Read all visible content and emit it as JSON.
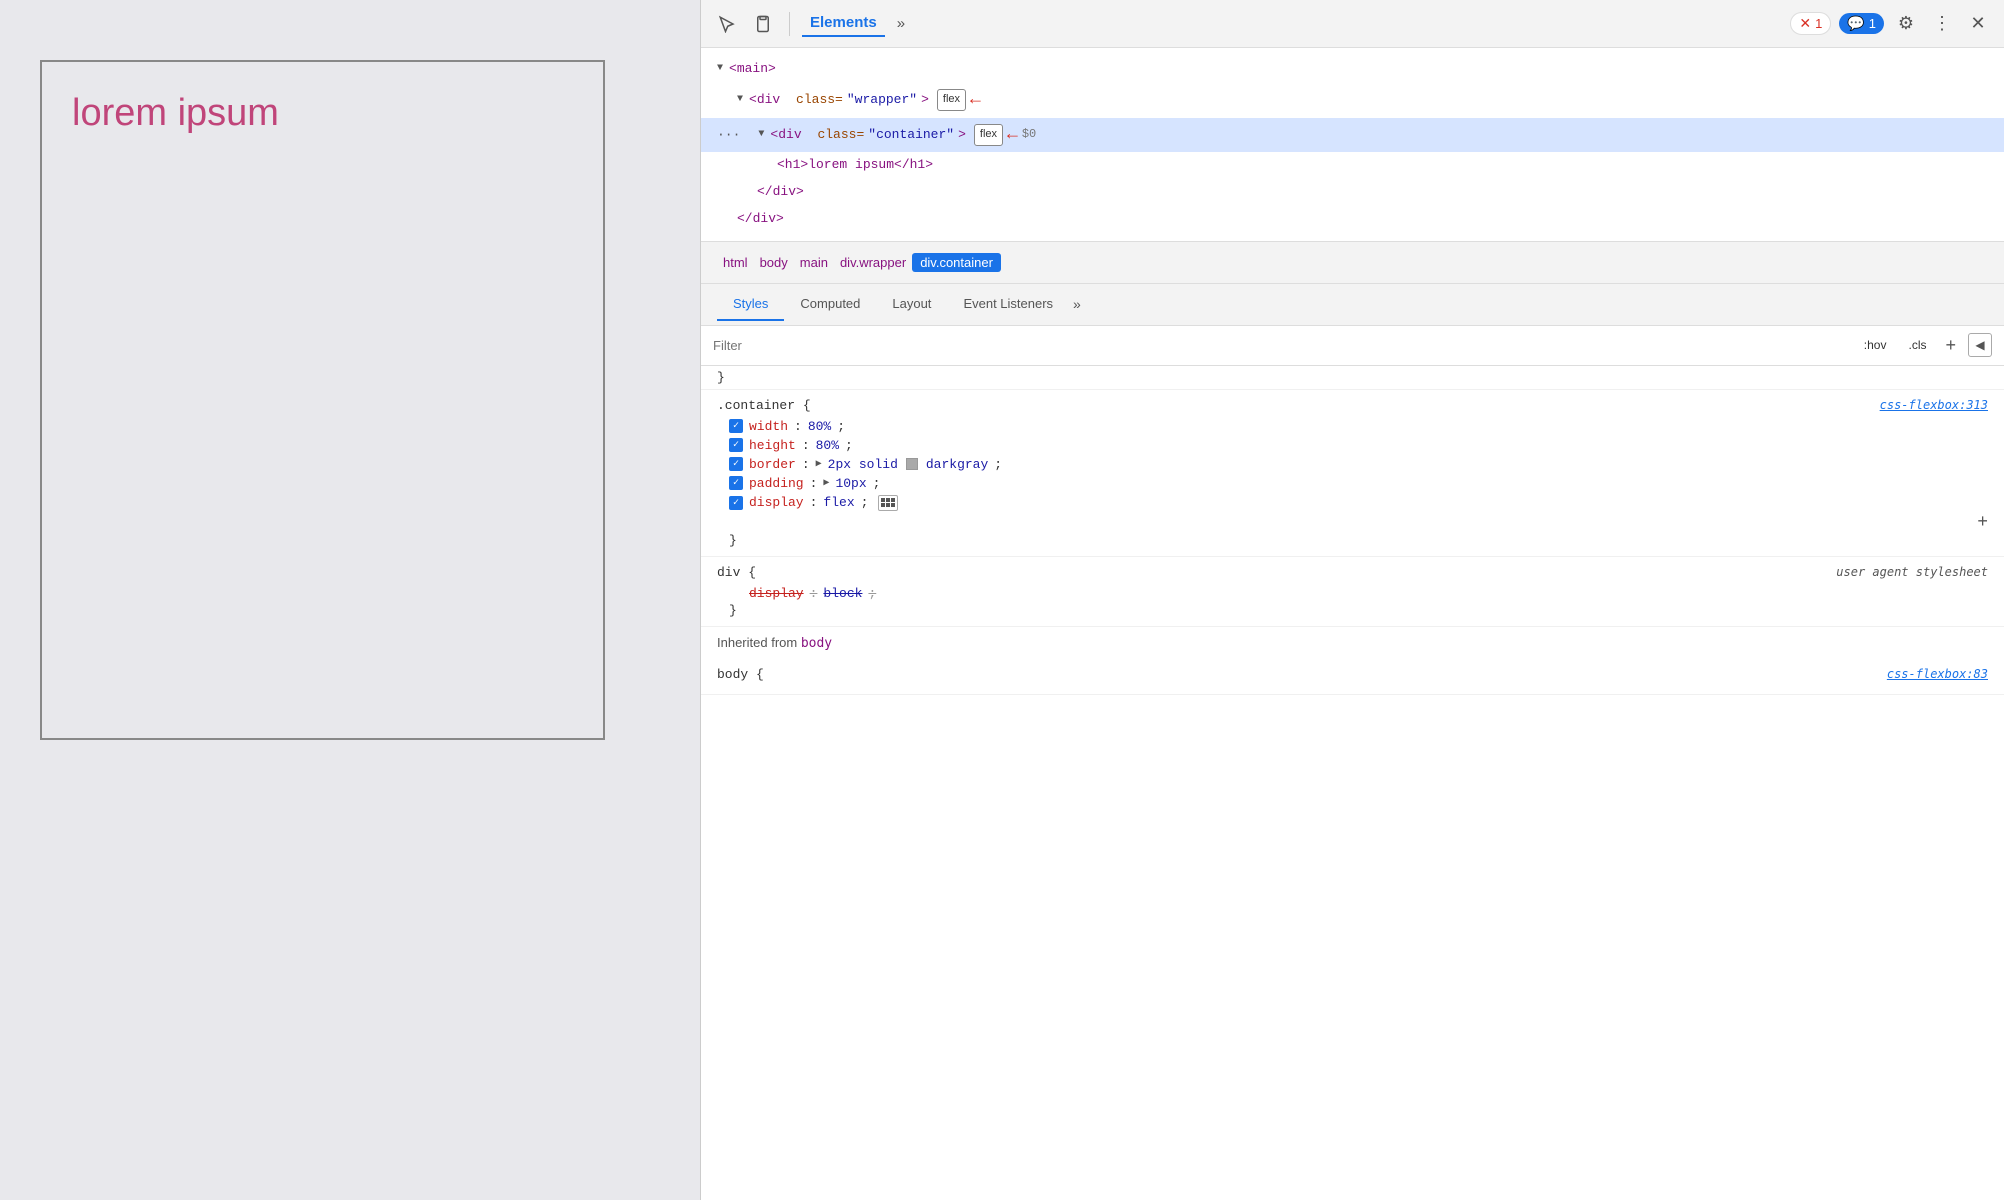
{
  "webpage": {
    "lorem_text": "lorem ipsum"
  },
  "devtools": {
    "toolbar": {
      "inspect_label": "inspect",
      "device_label": "device",
      "elements_tab": "Elements",
      "more_tabs": "»",
      "error_count": "1",
      "info_count": "1",
      "close_label": "×"
    },
    "dom_tree": {
      "main_tag": "<main>",
      "wrapper_open": "<div class=\"wrapper\">",
      "wrapper_flex": "flex",
      "container_open": "<div class=\"container\">",
      "container_flex": "flex",
      "h1_tag": "<h1>lorem ipsum</h1>",
      "div_close": "</div>",
      "main_close": "</div>"
    },
    "breadcrumb": {
      "items": [
        "html",
        "body",
        "main",
        "div.wrapper",
        "div.container"
      ]
    },
    "style_tabs": {
      "tabs": [
        "Styles",
        "Computed",
        "Layout",
        "Event Listeners"
      ],
      "more": "»",
      "active": "Styles"
    },
    "filter_bar": {
      "placeholder": "Filter",
      "hov_btn": ":hov",
      "cls_btn": ".cls",
      "add_btn": "+",
      "toggle_btn": "◀"
    },
    "css_rules": {
      "partial_top": "}",
      "container_rule": {
        "selector": ".container {",
        "source": "css-flexbox:313",
        "properties": [
          {
            "name": "width",
            "value": "80%",
            "checked": true,
            "strikethrough": false
          },
          {
            "name": "height",
            "value": "80%",
            "checked": true,
            "strikethrough": false
          },
          {
            "name": "border",
            "value": "2px solid",
            "color": "darkgray",
            "checked": true,
            "strikethrough": false,
            "has_color": true,
            "after_color": "darkgray;"
          },
          {
            "name": "padding",
            "value": "10px",
            "checked": true,
            "strikethrough": false,
            "has_triangle": true
          },
          {
            "name": "display",
            "value": "flex",
            "checked": true,
            "strikethrough": false,
            "has_flex_icon": true
          }
        ]
      },
      "div_ua_rule": {
        "selector": "div {",
        "source": "user agent stylesheet",
        "properties": [
          {
            "name": "display",
            "value": "block",
            "checked": false,
            "strikethrough": true
          }
        ]
      },
      "inherited_header": "Inherited from",
      "inherited_from": "body",
      "body_rule": {
        "selector": "body {",
        "source": "css-flexbox:83"
      }
    }
  }
}
